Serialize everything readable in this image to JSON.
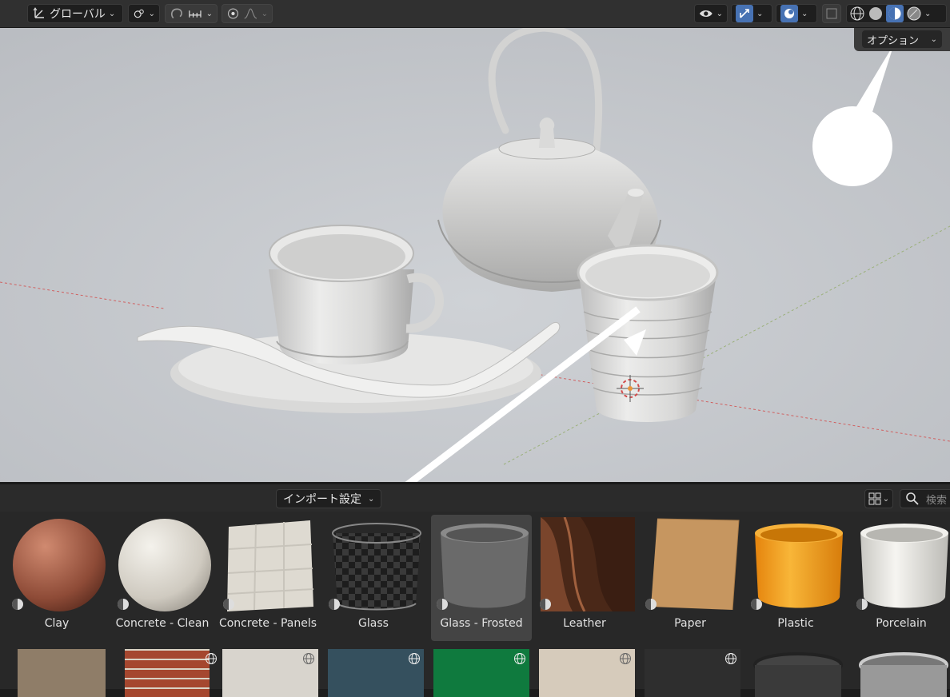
{
  "header": {
    "orientation_label": "グローバル"
  },
  "viewport": {
    "options_label": "オプション"
  },
  "browser": {
    "import_label": "インポート設定",
    "search_placeholder": "検索",
    "materials": [
      {
        "label": "Clay",
        "color": "#a4604a"
      },
      {
        "label": "Concrete - Clean",
        "color": "#e2ddd3"
      },
      {
        "label": "Concrete - Panels",
        "color": "#ddd9d0"
      },
      {
        "label": "Glass",
        "color": "#2a2a2a"
      },
      {
        "label": "Glass - Frosted",
        "color": "#6c6c6c"
      },
      {
        "label": "Leather",
        "color": "#5a3322"
      },
      {
        "label": "Paper",
        "color": "#c79a63"
      },
      {
        "label": "Plastic",
        "color": "#f2a21f"
      },
      {
        "label": "Porcelain",
        "color": "#ecebe6"
      }
    ],
    "selected": "Glass - Frosted"
  },
  "colors": {
    "viewport_bg": "#c3c6cb",
    "accent_blue": "#4772b3",
    "panel_bg": "#282828"
  }
}
